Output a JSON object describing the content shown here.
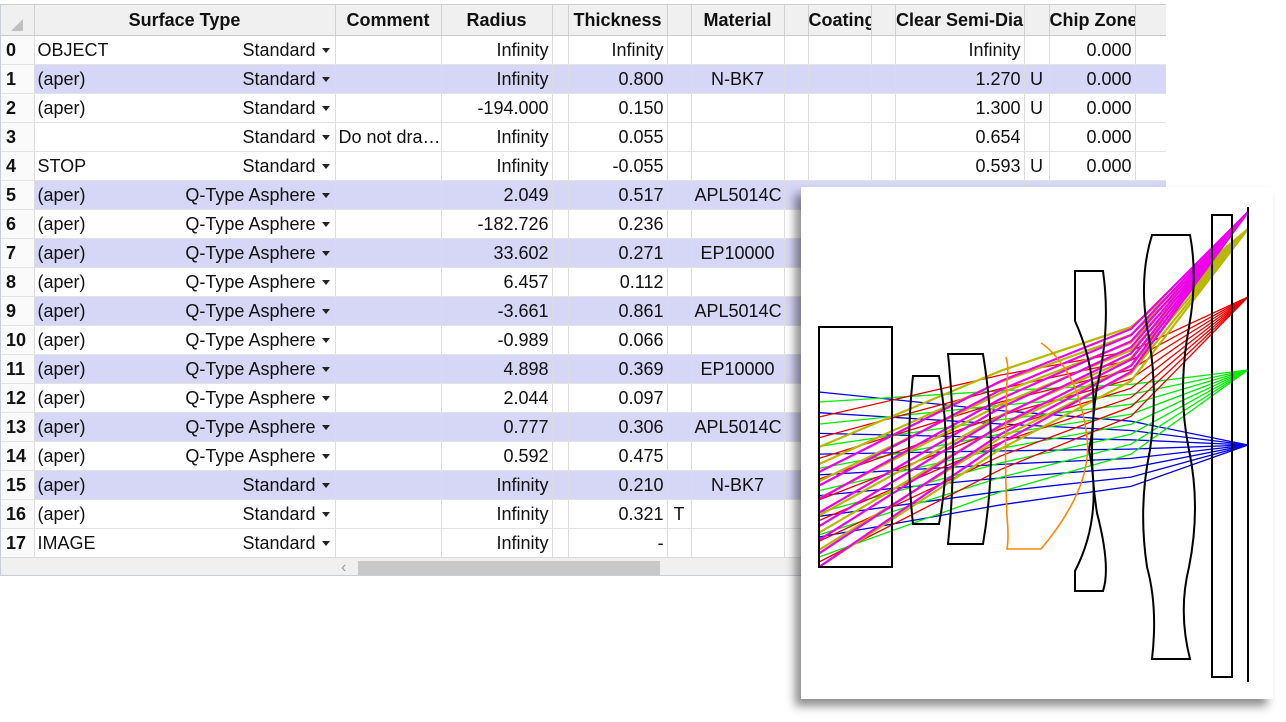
{
  "editor": {
    "columns": [
      "",
      "Surface Type",
      "Comment",
      "Radius",
      "",
      "Thickness",
      "",
      "Material",
      "",
      "Coating",
      "",
      "Clear Semi-Dia",
      "",
      "Chip Zone",
      ""
    ],
    "rows": [
      {
        "num": "0",
        "label": "OBJECT",
        "type": "Standard",
        "comment": "",
        "radius": "Infinity",
        "thickness": "Infinity",
        "thickness_solve": "",
        "material": "",
        "semi_dia": "Infinity",
        "semi_dia_solve": "",
        "chip_zone": "0.000"
      },
      {
        "num": "1",
        "label": "(aper)",
        "type": "Standard",
        "comment": "",
        "radius": "Infinity",
        "thickness": "0.800",
        "thickness_solve": "",
        "material": "N-BK7",
        "semi_dia": "1.270",
        "semi_dia_solve": "U",
        "chip_zone": "0.000"
      },
      {
        "num": "2",
        "label": "(aper)",
        "type": "Standard",
        "comment": "",
        "radius": "-194.000",
        "thickness": "0.150",
        "thickness_solve": "",
        "material": "",
        "semi_dia": "1.300",
        "semi_dia_solve": "U",
        "chip_zone": "0.000"
      },
      {
        "num": "3",
        "label": "",
        "type": "Standard",
        "comment": "Do not dra…",
        "radius": "Infinity",
        "thickness": "0.055",
        "thickness_solve": "",
        "material": "",
        "semi_dia": "0.654",
        "semi_dia_solve": "",
        "chip_zone": "0.000"
      },
      {
        "num": "4",
        "label": "STOP",
        "type": "Standard",
        "comment": "",
        "radius": "Infinity",
        "thickness": "-0.055",
        "thickness_solve": "",
        "material": "",
        "semi_dia": "0.593",
        "semi_dia_solve": "U",
        "chip_zone": "0.000"
      },
      {
        "num": "5",
        "label": "(aper)",
        "type": "Q-Type Asphere",
        "comment": "",
        "radius": "2.049",
        "thickness": "0.517",
        "thickness_solve": "",
        "material": "APL5014C",
        "semi_dia": "",
        "semi_dia_solve": "",
        "chip_zone": ""
      },
      {
        "num": "6",
        "label": "(aper)",
        "type": "Q-Type Asphere",
        "comment": "",
        "radius": "-182.726",
        "thickness": "0.236",
        "thickness_solve": "",
        "material": "",
        "semi_dia": "",
        "semi_dia_solve": "",
        "chip_zone": ""
      },
      {
        "num": "7",
        "label": "(aper)",
        "type": "Q-Type Asphere",
        "comment": "",
        "radius": "33.602",
        "thickness": "0.271",
        "thickness_solve": "",
        "material": "EP10000",
        "semi_dia": "",
        "semi_dia_solve": "",
        "chip_zone": ""
      },
      {
        "num": "8",
        "label": "(aper)",
        "type": "Q-Type Asphere",
        "comment": "",
        "radius": "6.457",
        "thickness": "0.112",
        "thickness_solve": "",
        "material": "",
        "semi_dia": "",
        "semi_dia_solve": "",
        "chip_zone": ""
      },
      {
        "num": "9",
        "label": "(aper)",
        "type": "Q-Type Asphere",
        "comment": "",
        "radius": "-3.661",
        "thickness": "0.861",
        "thickness_solve": "",
        "material": "APL5014C",
        "semi_dia": "",
        "semi_dia_solve": "",
        "chip_zone": ""
      },
      {
        "num": "10",
        "label": "(aper)",
        "type": "Q-Type Asphere",
        "comment": "",
        "radius": "-0.989",
        "thickness": "0.066",
        "thickness_solve": "",
        "material": "",
        "semi_dia": "",
        "semi_dia_solve": "",
        "chip_zone": ""
      },
      {
        "num": "11",
        "label": "(aper)",
        "type": "Q-Type Asphere",
        "comment": "",
        "radius": "4.898",
        "thickness": "0.369",
        "thickness_solve": "",
        "material": "EP10000",
        "semi_dia": "",
        "semi_dia_solve": "",
        "chip_zone": ""
      },
      {
        "num": "12",
        "label": "(aper)",
        "type": "Q-Type Asphere",
        "comment": "",
        "radius": "2.044",
        "thickness": "0.097",
        "thickness_solve": "",
        "material": "",
        "semi_dia": "",
        "semi_dia_solve": "",
        "chip_zone": ""
      },
      {
        "num": "13",
        "label": "(aper)",
        "type": "Q-Type Asphere",
        "comment": "",
        "radius": "0.777",
        "thickness": "0.306",
        "thickness_solve": "",
        "material": "APL5014C",
        "semi_dia": "",
        "semi_dia_solve": "",
        "chip_zone": ""
      },
      {
        "num": "14",
        "label": "(aper)",
        "type": "Q-Type Asphere",
        "comment": "",
        "radius": "0.592",
        "thickness": "0.475",
        "thickness_solve": "",
        "material": "",
        "semi_dia": "",
        "semi_dia_solve": "",
        "chip_zone": ""
      },
      {
        "num": "15",
        "label": "(aper)",
        "type": "Standard",
        "comment": "",
        "radius": "Infinity",
        "thickness": "0.210",
        "thickness_solve": "",
        "material": "N-BK7",
        "semi_dia": "",
        "semi_dia_solve": "",
        "chip_zone": ""
      },
      {
        "num": "16",
        "label": "(aper)",
        "type": "Standard",
        "comment": "",
        "radius": "Infinity",
        "thickness": "0.321",
        "thickness_solve": "T",
        "material": "",
        "semi_dia": "",
        "semi_dia_solve": "",
        "chip_zone": ""
      },
      {
        "num": "17",
        "label": "IMAGE",
        "type": "Standard",
        "comment": "",
        "radius": "Infinity",
        "thickness": "-",
        "thickness_solve": "",
        "material": "",
        "semi_dia": "",
        "semi_dia_solve": "",
        "chip_zone": ""
      }
    ],
    "highlighted_rows": [
      1,
      5,
      7,
      9,
      11,
      13,
      15
    ]
  },
  "layout_plot": {
    "field_colors": [
      "#0000ee",
      "#00ee00",
      "#ee0000",
      "#b8b800",
      "#ee00ee"
    ],
    "lens_color": "#000000",
    "stop_color": "#ff8800"
  }
}
